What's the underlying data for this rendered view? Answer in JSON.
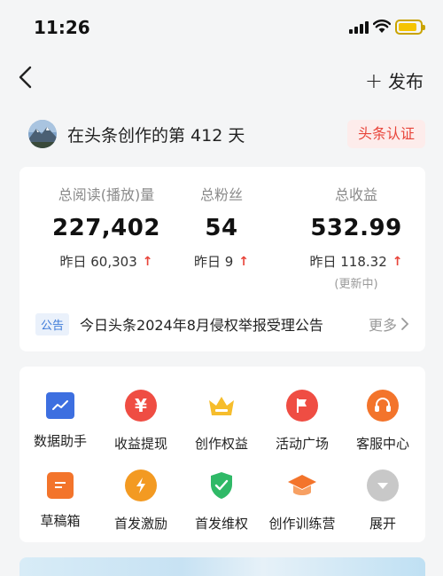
{
  "status_bar": {
    "time": "11:26"
  },
  "nav": {
    "publish_label": "发布"
  },
  "profile": {
    "creation_text": "在头条创作的第 412 天",
    "badge": "头条认证"
  },
  "stats": [
    {
      "label": "总阅读(播放)量",
      "value": "227,402",
      "delta": "昨日 60,303",
      "note": ""
    },
    {
      "label": "总粉丝",
      "value": "54",
      "delta": "昨日 9",
      "note": ""
    },
    {
      "label": "总收益",
      "value": "532.99",
      "delta": "昨日 118.32",
      "note": "(更新中)"
    }
  ],
  "notice": {
    "tag": "公告",
    "text": "今日头条2024年8月侵权举报受理公告",
    "more": "更多"
  },
  "tools": [
    {
      "label": "数据助手",
      "icon": "chart-icon",
      "color": "#3d6fe0"
    },
    {
      "label": "收益提现",
      "icon": "yuan-icon",
      "color": "#ef4d43"
    },
    {
      "label": "创作权益",
      "icon": "crown-icon",
      "color": "#f6bd2c"
    },
    {
      "label": "活动广场",
      "icon": "flag-icon",
      "color": "#ef4d43"
    },
    {
      "label": "客服中心",
      "icon": "headset-icon",
      "color": "#f3742b"
    },
    {
      "label": "草稿箱",
      "icon": "draft-icon",
      "color": "#f3742b"
    },
    {
      "label": "首发激励",
      "icon": "lightning-icon",
      "color": "#f39a22"
    },
    {
      "label": "首发维权",
      "icon": "shield-icon",
      "color": "#2fb967"
    },
    {
      "label": "创作训练营",
      "icon": "graduation-cap-icon",
      "color": "#f3742b"
    },
    {
      "label": "展开",
      "icon": "chevron-down-icon",
      "color": "#c8c8c8"
    }
  ]
}
